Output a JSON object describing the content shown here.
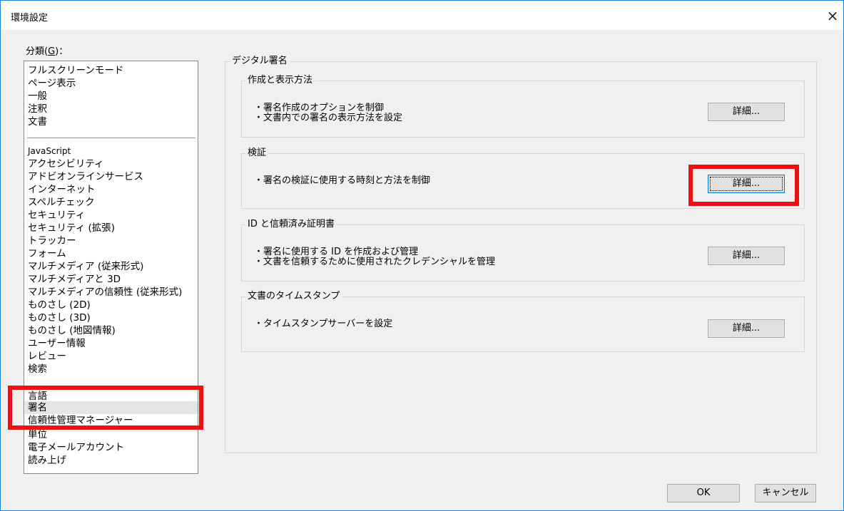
{
  "window": {
    "title": "環境設定",
    "close_glyph": "×"
  },
  "categories": {
    "label_prefix": "分類(",
    "label_key": "G",
    "label_suffix": ")：",
    "items": [
      "フルスクリーンモード",
      "ページ表示",
      "一般",
      "注釈",
      "文書",
      "JavaScript",
      "アクセシビリティ",
      "アドビオンラインサービス",
      "インターネット",
      "スペルチェック",
      "セキュリティ",
      "セキュリティ (拡張)",
      "トラッカー",
      "フォーム",
      "マルチメディア (従来形式)",
      "マルチメディアと 3D",
      "マルチメディアの信頼性 (従来形式)",
      "ものさし (2D)",
      "ものさし (3D)",
      "ものさし (地図情報)",
      "ユーザー情報",
      "レビュー",
      "検索",
      "言語",
      "署名",
      "信頼性管理マネージャー",
      "単位",
      "電子メールアカウント",
      "読み上げ"
    ],
    "selected": "署名"
  },
  "panel": {
    "title": "デジタル署名",
    "sections": [
      {
        "title": "作成と表示方法",
        "lines": [
          "・署名作成のオプションを制御",
          "・文書内での署名の表示方法を設定"
        ],
        "button": "詳細..."
      },
      {
        "title": "検証",
        "lines": [
          "・署名の検証に使用する時刻と方法を制御"
        ],
        "button": "詳細..."
      },
      {
        "title": "ID と信頼済み証明書",
        "lines": [
          "・署名に使用する ID を作成および管理",
          "・文書を信頼するために使用されたクレデンシャルを管理"
        ],
        "button": "詳細..."
      },
      {
        "title": "文書のタイムスタンプ",
        "lines": [
          "・タイムスタンプサーバーを設定"
        ],
        "button": "詳細..."
      }
    ]
  },
  "footer": {
    "ok": "OK",
    "cancel": "キャンセル"
  },
  "colors": {
    "highlight_annotation": "#ee1111",
    "window_border": "#1883d7"
  }
}
